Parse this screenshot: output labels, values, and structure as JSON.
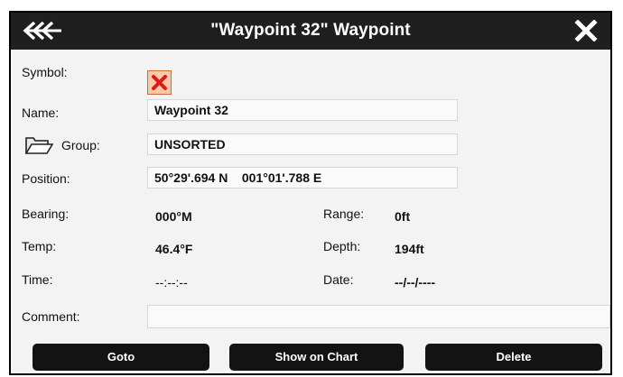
{
  "dialog": {
    "title": "\"Waypoint 32\" Waypoint",
    "back_icon": "triple-chevron-left-icon",
    "close_icon": "close-x-icon"
  },
  "symbol": {
    "label": "Symbol:",
    "icon": "red-x-waypoint-symbol",
    "color": "#e01818"
  },
  "name": {
    "label": "Name:",
    "value": "Waypoint 32"
  },
  "group": {
    "label": "Group:",
    "value": "UNSORTED",
    "icon": "folder-icon"
  },
  "position": {
    "label": "Position:",
    "value": "50°29'.694 N    001°01'.788 E"
  },
  "bearing": {
    "label": "Bearing:",
    "value": "000°M"
  },
  "range": {
    "label": "Range:",
    "value": "0ft"
  },
  "temp": {
    "label": "Temp:",
    "value": "46.4°F"
  },
  "depth": {
    "label": "Depth:",
    "value": "194ft"
  },
  "time": {
    "label": "Time:",
    "value": "--:--:--"
  },
  "date": {
    "label": "Date:",
    "value": "--/--/----"
  },
  "comment": {
    "label": "Comment:",
    "value": ""
  },
  "buttons": {
    "goto": "Goto",
    "show_on_chart": "Show on Chart",
    "delete": "Delete"
  }
}
